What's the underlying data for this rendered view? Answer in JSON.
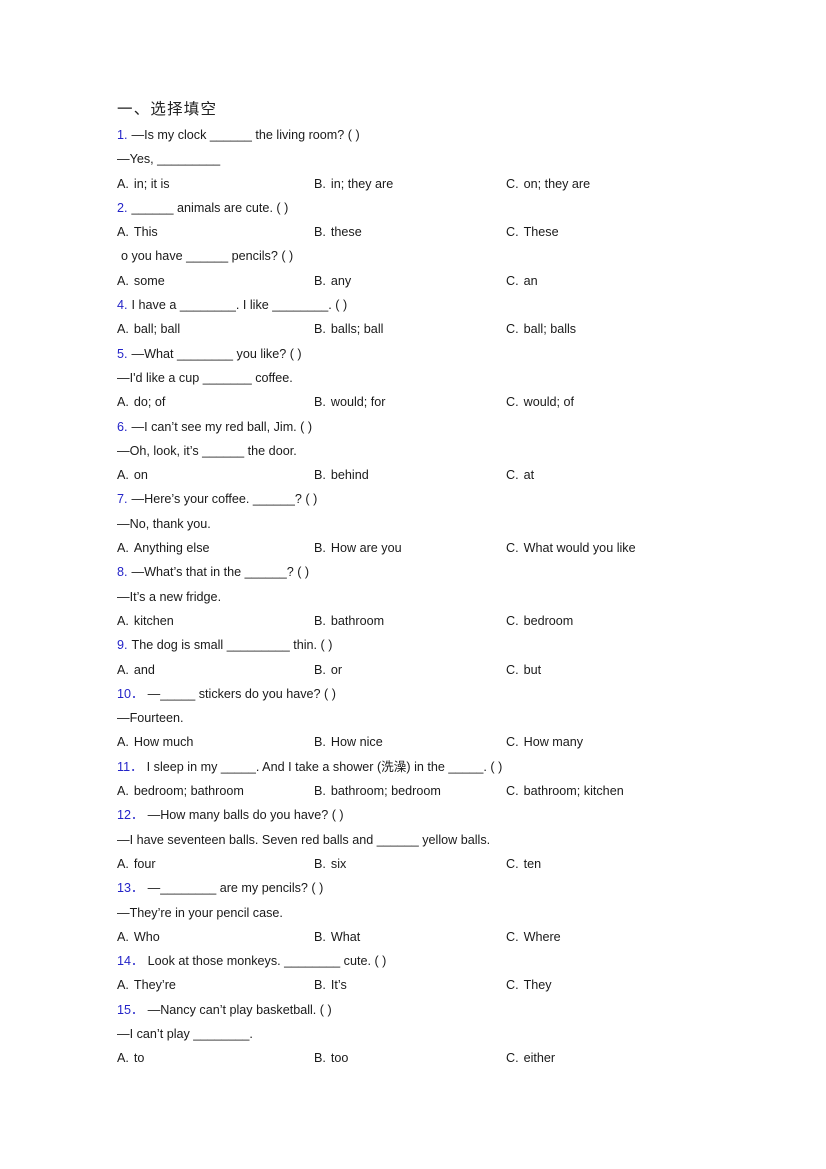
{
  "document": {
    "section_title": "一、选择填空"
  },
  "questions": [
    {
      "number": "1.",
      "stem": "—Is my clock ______ the living room? (  )",
      "extra_lines": [
        "—Yes, _________"
      ],
      "options": [
        {
          "label": "A.",
          "text": "in; it is"
        },
        {
          "label": "B.",
          "text": "in; they are"
        },
        {
          "label": "C.",
          "text": "on; they are"
        }
      ]
    },
    {
      "number": "2.",
      "stem": "______ animals are cute. (  )",
      "extra_lines": [],
      "options": [
        {
          "label": "A.",
          "text": "This"
        },
        {
          "label": "B.",
          "text": "these"
        },
        {
          "label": "C.",
          "text": "These"
        }
      ]
    },
    {
      "number": "",
      "stem": "o you have ______ pencils? (  )",
      "extra_lines": [],
      "options": [
        {
          "label": "A.",
          "text": "some"
        },
        {
          "label": "B.",
          "text": "any"
        },
        {
          "label": "C.",
          "text": "an"
        }
      ]
    },
    {
      "number": "4.",
      "stem": "I have a ________. I like ________. (   )",
      "extra_lines": [],
      "options": [
        {
          "label": "A.",
          "text": "ball; ball"
        },
        {
          "label": "B.",
          "text": "balls; ball"
        },
        {
          "label": "C.",
          "text": "ball; balls"
        }
      ]
    },
    {
      "number": "5.",
      "stem": "—What ________ you like? (  )",
      "extra_lines": [
        "—I'd like a cup _______ coffee."
      ],
      "options": [
        {
          "label": "A.",
          "text": "do; of"
        },
        {
          "label": "B.",
          "text": "would; for"
        },
        {
          "label": "C.",
          "text": "would; of"
        }
      ]
    },
    {
      "number": "6.",
      "stem": "—I can’t see my red ball, Jim. (   )",
      "extra_lines": [
        "—Oh, look, it’s ______ the door."
      ],
      "options": [
        {
          "label": "A.",
          "text": "on"
        },
        {
          "label": "B.",
          "text": "behind"
        },
        {
          "label": "C.",
          "text": "at"
        }
      ]
    },
    {
      "number": "7.",
      "stem": "—Here’s your coffee. ______? (  )",
      "extra_lines": [
        "—No, thank you."
      ],
      "options": [
        {
          "label": "A.",
          "text": "Anything else"
        },
        {
          "label": "B.",
          "text": "How are you"
        },
        {
          "label": "C.",
          "text": "What would you like"
        }
      ]
    },
    {
      "number": "8.",
      "stem": "—What’s that in the ______? (   )",
      "extra_lines": [
        "—It’s a new fridge."
      ],
      "options": [
        {
          "label": "A.",
          "text": "kitchen"
        },
        {
          "label": "B.",
          "text": "bathroom"
        },
        {
          "label": "C.",
          "text": "bedroom"
        }
      ]
    },
    {
      "number": "9.",
      "stem": "The dog is small _________ thin. (   )",
      "extra_lines": [],
      "options": [
        {
          "label": "A.",
          "text": "and"
        },
        {
          "label": "B.",
          "text": "or"
        },
        {
          "label": "C.",
          "text": "but"
        }
      ]
    },
    {
      "number": "10．",
      "stem": "—_____ stickers do you have? (   )",
      "extra_lines": [
        "—Fourteen."
      ],
      "options": [
        {
          "label": "A.",
          "text": "How much"
        },
        {
          "label": "B.",
          "text": "How nice"
        },
        {
          "label": "C.",
          "text": "How many"
        }
      ]
    },
    {
      "number": "11．",
      "stem": "I sleep in my _____. And I take a shower (洗澡) in the _____. (   )",
      "extra_lines": [],
      "options": [
        {
          "label": "A.",
          "text": "bedroom; bathroom"
        },
        {
          "label": "B.",
          "text": "bathroom; bedroom"
        },
        {
          "label": "C.",
          "text": "bathroom; kitchen"
        }
      ]
    },
    {
      "number": "12．",
      "stem": "—How many balls do you have? (   )",
      "extra_lines": [
        "—I have seventeen balls. Seven red balls and ______ yellow balls."
      ],
      "options": [
        {
          "label": "A.",
          "text": "four"
        },
        {
          "label": "B.",
          "text": "six"
        },
        {
          "label": "C.",
          "text": "ten"
        }
      ]
    },
    {
      "number": "13．",
      "stem": "—________ are my pencils? (   )",
      "extra_lines": [
        "—They’re in your pencil case."
      ],
      "options": [
        {
          "label": "A.",
          "text": "Who"
        },
        {
          "label": "B.",
          "text": "What"
        },
        {
          "label": "C.",
          "text": "Where"
        }
      ]
    },
    {
      "number": "14．",
      "stem": "Look at those monkeys. ________ cute. (   )",
      "extra_lines": [],
      "options": [
        {
          "label": "A.",
          "text": "They’re"
        },
        {
          "label": "B.",
          "text": "It’s"
        },
        {
          "label": "C.",
          "text": "They"
        }
      ]
    },
    {
      "number": "15．",
      "stem": "—Nancy can’t play basketball. (  )",
      "extra_lines": [
        "—I can’t play ________."
      ],
      "options": [
        {
          "label": "A.",
          "text": "to"
        },
        {
          "label": "B.",
          "text": "too"
        },
        {
          "label": "C.",
          "text": "either"
        }
      ]
    }
  ],
  "colors": {
    "number_blue": "#2424c8",
    "body_text": "#1a1a1a",
    "page_background": "#ffffff"
  }
}
